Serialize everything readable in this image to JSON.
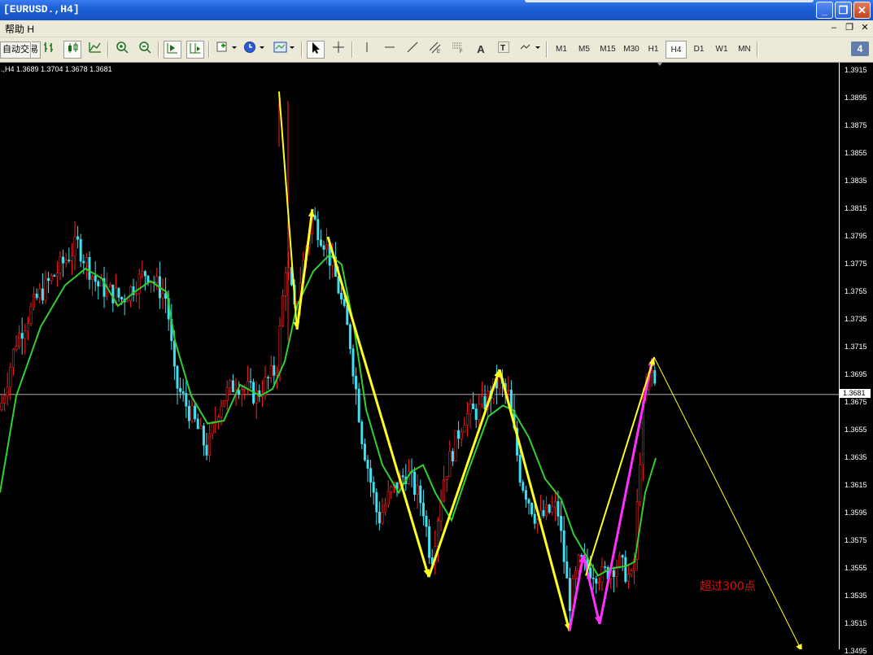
{
  "window": {
    "title": "[EURUSD.,H4]",
    "buttons": {
      "minimize": "_",
      "restore": "❐",
      "close": "✕"
    }
  },
  "menubar": {
    "help_label": "帮助 H",
    "mdi_minimize": "–",
    "mdi_restore": "❐",
    "mdi_close": "✕"
  },
  "toolbar": {
    "trade_label": "自动交易",
    "timeframes": [
      "M1",
      "M5",
      "M15",
      "M30",
      "H1",
      "H4",
      "D1",
      "W1",
      "MN"
    ],
    "active_timeframe": "H4",
    "text_tool": "A",
    "badge": "4"
  },
  "chart": {
    "info_line": ".,H4  1.3689 1.3704 1.3678 1.3681",
    "current_price": "1.3681",
    "annotation": "超过300点",
    "price_labels": [
      "1.3915",
      "1.3895",
      "1.3875",
      "1.3855",
      "1.3835",
      "1.3815",
      "1.3795",
      "1.3775",
      "1.3755",
      "1.3735",
      "1.3715",
      "1.3695",
      "1.3675",
      "1.3655",
      "1.3635",
      "1.3615",
      "1.3595",
      "1.3575",
      "1.3555",
      "1.3535",
      "1.3515",
      "1.3495"
    ],
    "colors": {
      "background": "#000000",
      "bull": "#ff2020",
      "bear": "#40e0f0",
      "ma": "#30d030",
      "arrow": "#ffff20",
      "arrow_alt": "#ff30ff",
      "annotation": "#e01010"
    }
  }
}
